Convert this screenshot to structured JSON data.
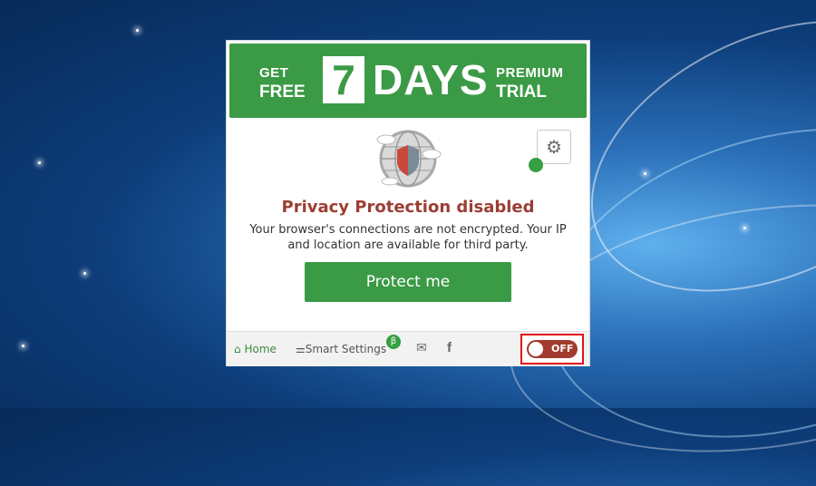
{
  "banner": {
    "get": "GET",
    "free": "FREE",
    "number": "7",
    "days": "DAYS",
    "premium": "PREMIUM",
    "trial": "TRIAL"
  },
  "status": {
    "title": "Privacy Protection disabled",
    "description": "Your browser's connections are not encrypted. Your IP and location are available for third party."
  },
  "actions": {
    "protect_label": "Protect me"
  },
  "footer": {
    "home_label": "Home",
    "smart_settings_label": "Smart Settings",
    "beta_badge": "β",
    "toggle_label": "OFF"
  },
  "icons": {
    "settings": "gear-icon",
    "home": "home-icon",
    "smart_settings": "sliders-icon",
    "mail": "mail-icon",
    "facebook": "facebook-icon",
    "globe": "globe-shield-icon"
  },
  "colors": {
    "accent_green": "#3b9a45",
    "disabled_red": "#9b3e33",
    "toggle_off": "#a23b2e",
    "highlight_box": "#e0141a"
  }
}
